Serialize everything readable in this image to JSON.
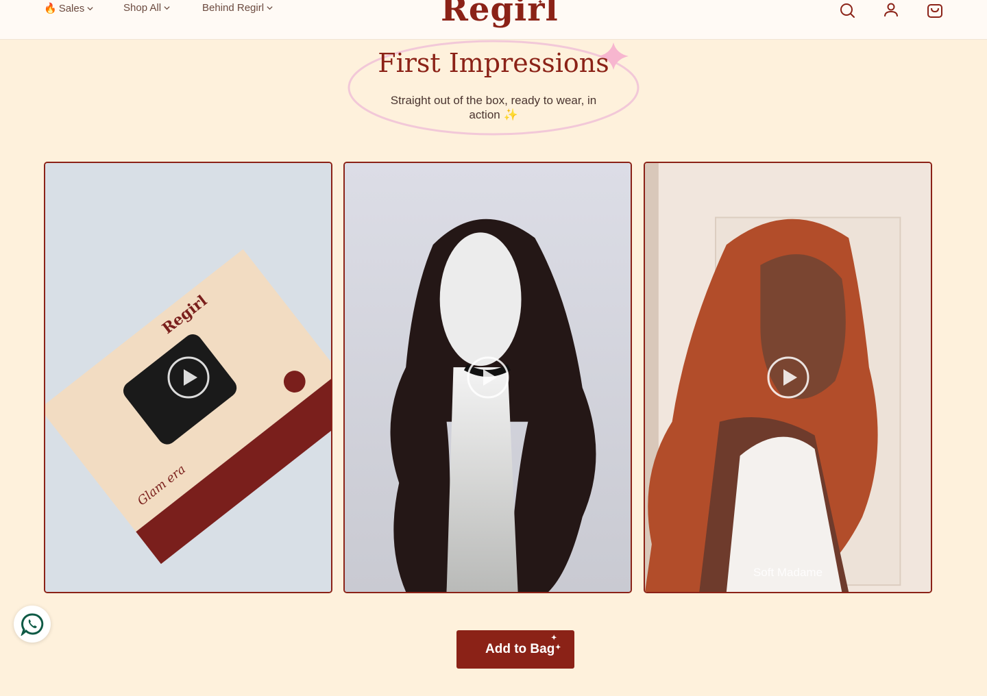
{
  "header": {
    "nav": [
      {
        "emoji": "🔥",
        "label": "Sales"
      },
      {
        "label": "Shop All"
      },
      {
        "label": "Behind Regirl"
      }
    ],
    "logo": "Regirl",
    "icons": [
      "search-icon",
      "account-icon",
      "bag-icon"
    ]
  },
  "hero": {
    "title": "First Impressions",
    "subtitle": "Straight out of the box, ready to wear, in action ✨"
  },
  "videos": [
    {
      "caption": ""
    },
    {
      "caption": ""
    },
    {
      "caption": "Soft Madame"
    }
  ],
  "add_to_bag": "Add to Bag",
  "colors": {
    "brand": "#8b2217",
    "background": "#fef1dc",
    "oval": "#f2c8d8"
  }
}
